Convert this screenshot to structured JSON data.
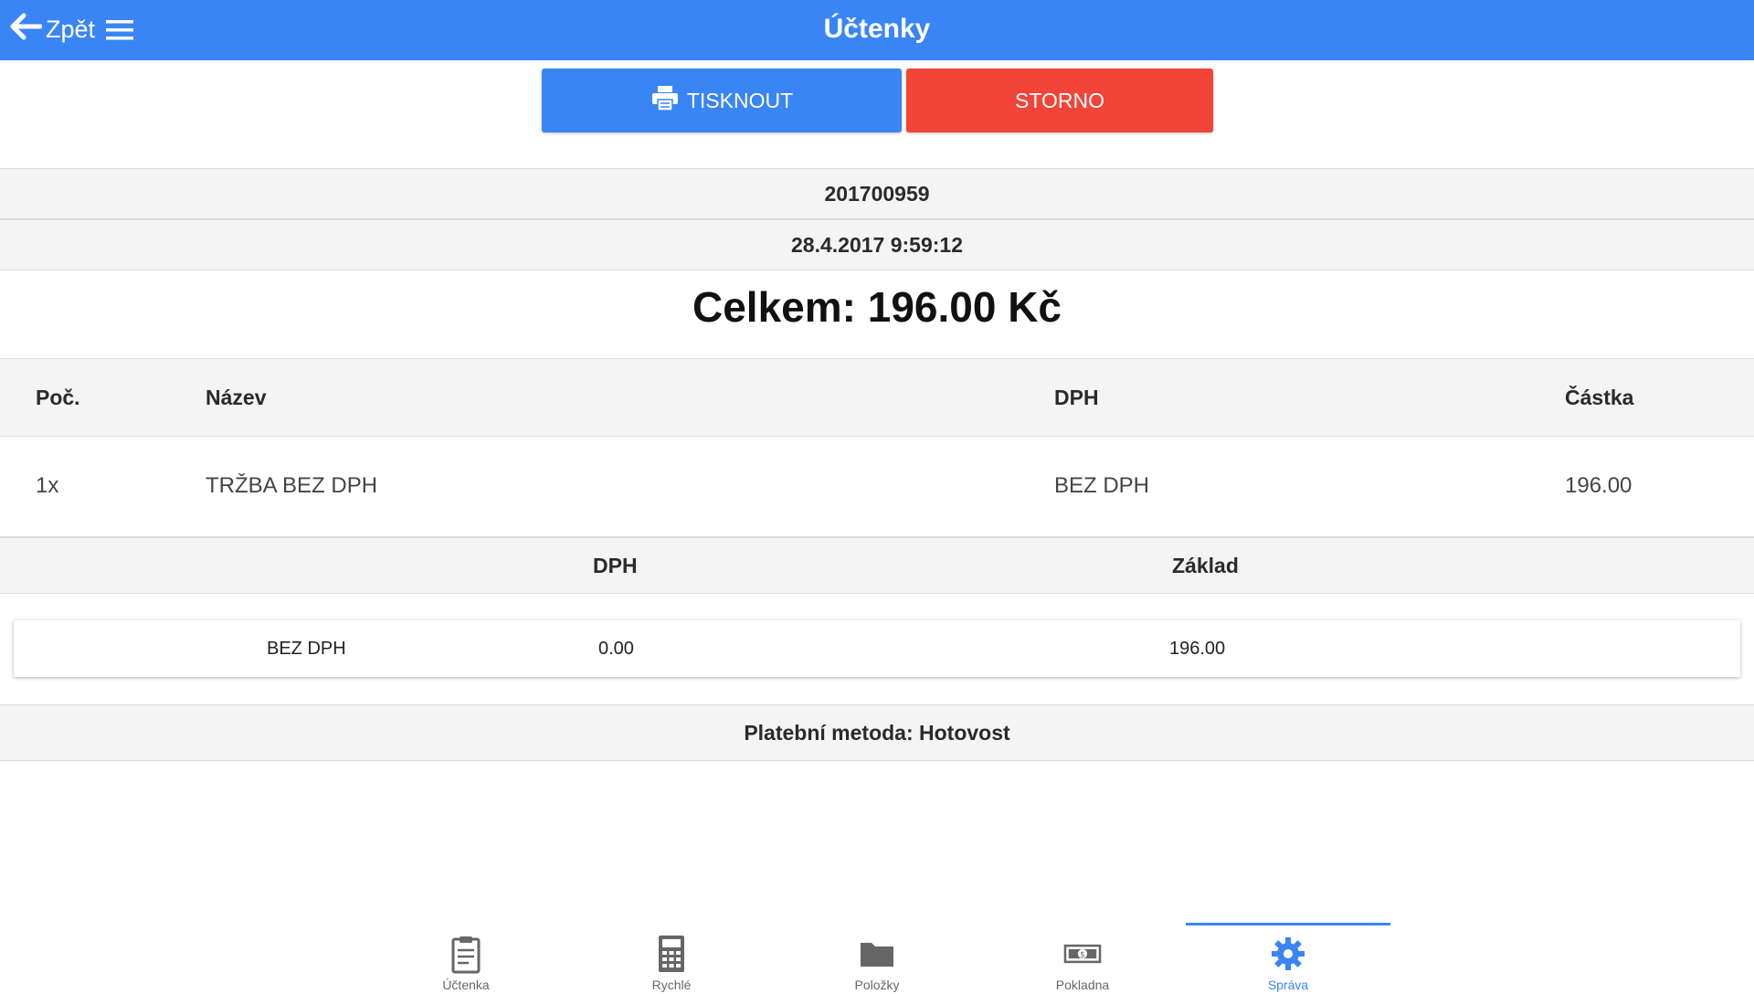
{
  "header": {
    "back_label": "Zpět",
    "title": "Účtenky"
  },
  "actions": {
    "print_label": "TISKNOUT",
    "storno_label": "STORNO"
  },
  "receipt": {
    "number": "201700959",
    "datetime": "28.4.2017 9:59:12",
    "total": "Celkem: 196.00 Kč"
  },
  "items_table": {
    "headers": {
      "qty": "Poč.",
      "name": "Název",
      "vat": "DPH",
      "amount": "Částka"
    },
    "rows": [
      {
        "qty": "1x",
        "name": "TRŽBA BEZ DPH",
        "vat": "BEZ DPH",
        "amount": "196.00"
      }
    ]
  },
  "vat_table": {
    "headers": {
      "vat": "DPH",
      "base": "Základ"
    },
    "rows": [
      {
        "rate": "BEZ DPH",
        "vat": "0.00",
        "base": "196.00"
      }
    ]
  },
  "payment": "Platební metoda: Hotovost",
  "nav": {
    "items": [
      {
        "label": "Účtenka",
        "icon": "clipboard-icon"
      },
      {
        "label": "Rychlé",
        "icon": "calculator-icon"
      },
      {
        "label": "Položky",
        "icon": "folder-icon"
      },
      {
        "label": "Pokladna",
        "icon": "money-icon"
      },
      {
        "label": "Správa",
        "icon": "gear-icon",
        "active": true
      }
    ]
  },
  "colors": {
    "primary": "#3a85f5",
    "danger": "#f24438",
    "band": "#f4f4f4"
  }
}
